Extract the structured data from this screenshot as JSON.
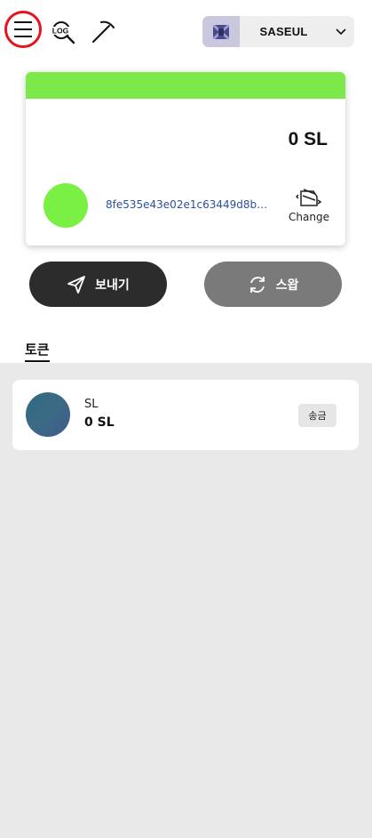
{
  "header": {
    "menu_icon": "hamburger-icon",
    "log_icon": "log-search-icon",
    "log_label": "LOG",
    "mining_icon": "pickaxe-icon",
    "network": {
      "logo_icon": "network-logo-icon",
      "name": "SASEUL",
      "dropdown_icon": "chevron-down-icon"
    }
  },
  "account_card": {
    "accent_color": "#7ce84a",
    "balance": "0 SL",
    "avatar_color": "#7af045",
    "address": "8fe535e43e02e1c63449d8bbd…",
    "change_icon": "wallet-switch-icon",
    "change_label": "Change"
  },
  "actions": {
    "send_label": "보내기",
    "send_icon": "paper-plane-icon",
    "swap_label": "스왑",
    "swap_icon": "refresh-icon"
  },
  "tokens": {
    "tab_label": "토큰",
    "items": [
      {
        "symbol": "SL",
        "balance": "0 SL",
        "action_label": "송금"
      }
    ]
  }
}
